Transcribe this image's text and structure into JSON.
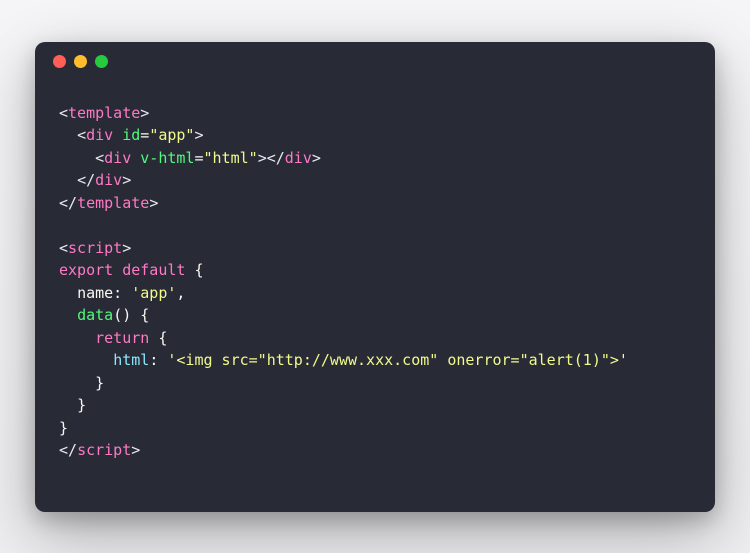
{
  "window": {
    "traffic_lights": [
      "close",
      "minimize",
      "maximize"
    ]
  },
  "code": {
    "lines": [
      {
        "indent": 0,
        "tokens": [
          {
            "cls": "tag-bracket",
            "t": "<"
          },
          {
            "cls": "tag-name",
            "t": "template"
          },
          {
            "cls": "tag-bracket",
            "t": ">"
          }
        ]
      },
      {
        "indent": 1,
        "tokens": [
          {
            "cls": "tag-bracket",
            "t": "<"
          },
          {
            "cls": "tag-name",
            "t": "div"
          },
          {
            "cls": "punct",
            "t": " "
          },
          {
            "cls": "attr-name",
            "t": "id"
          },
          {
            "cls": "punct",
            "t": "="
          },
          {
            "cls": "attr-val",
            "t": "\"app\""
          },
          {
            "cls": "tag-bracket",
            "t": ">"
          }
        ]
      },
      {
        "indent": 2,
        "tokens": [
          {
            "cls": "tag-bracket",
            "t": "<"
          },
          {
            "cls": "tag-name",
            "t": "div"
          },
          {
            "cls": "punct",
            "t": " "
          },
          {
            "cls": "attr-name",
            "t": "v-html"
          },
          {
            "cls": "punct",
            "t": "="
          },
          {
            "cls": "attr-val",
            "t": "\"html\""
          },
          {
            "cls": "tag-bracket",
            "t": ">"
          },
          {
            "cls": "tag-bracket",
            "t": "</"
          },
          {
            "cls": "tag-name",
            "t": "div"
          },
          {
            "cls": "tag-bracket",
            "t": ">"
          }
        ]
      },
      {
        "indent": 1,
        "tokens": [
          {
            "cls": "tag-bracket",
            "t": "</"
          },
          {
            "cls": "tag-name",
            "t": "div"
          },
          {
            "cls": "tag-bracket",
            "t": ">"
          }
        ]
      },
      {
        "indent": 0,
        "tokens": [
          {
            "cls": "tag-bracket",
            "t": "</"
          },
          {
            "cls": "tag-name",
            "t": "template"
          },
          {
            "cls": "tag-bracket",
            "t": ">"
          }
        ]
      },
      {
        "indent": 0,
        "tokens": []
      },
      {
        "indent": 0,
        "tokens": [
          {
            "cls": "tag-bracket",
            "t": "<"
          },
          {
            "cls": "tag-name",
            "t": "script"
          },
          {
            "cls": "tag-bracket",
            "t": ">"
          }
        ]
      },
      {
        "indent": 0,
        "tokens": [
          {
            "cls": "keyword-pink",
            "t": "export"
          },
          {
            "cls": "punct",
            "t": " "
          },
          {
            "cls": "keyword-pink",
            "t": "default"
          },
          {
            "cls": "punct",
            "t": " {"
          }
        ]
      },
      {
        "indent": 1,
        "tokens": [
          {
            "cls": "punct",
            "t": "name: "
          },
          {
            "cls": "string",
            "t": "'app'"
          },
          {
            "cls": "punct",
            "t": ","
          }
        ]
      },
      {
        "indent": 1,
        "tokens": [
          {
            "cls": "method",
            "t": "data"
          },
          {
            "cls": "punct",
            "t": "() {"
          }
        ]
      },
      {
        "indent": 2,
        "tokens": [
          {
            "cls": "keyword-pink",
            "t": "return"
          },
          {
            "cls": "punct",
            "t": " {"
          }
        ]
      },
      {
        "indent": 3,
        "tokens": [
          {
            "cls": "prop",
            "t": "html"
          },
          {
            "cls": "punct",
            "t": ": "
          },
          {
            "cls": "string",
            "t": "'<img src=\"http://www.xxx.com\" onerror=\"alert(1)\">'"
          }
        ]
      },
      {
        "indent": 2,
        "tokens": [
          {
            "cls": "punct",
            "t": "}"
          }
        ]
      },
      {
        "indent": 1,
        "tokens": [
          {
            "cls": "punct",
            "t": "}"
          }
        ]
      },
      {
        "indent": 0,
        "tokens": [
          {
            "cls": "punct",
            "t": "}"
          }
        ]
      },
      {
        "indent": 0,
        "tokens": [
          {
            "cls": "tag-bracket",
            "t": "</"
          },
          {
            "cls": "tag-name",
            "t": "script"
          },
          {
            "cls": "tag-bracket",
            "t": ">"
          }
        ]
      }
    ]
  }
}
